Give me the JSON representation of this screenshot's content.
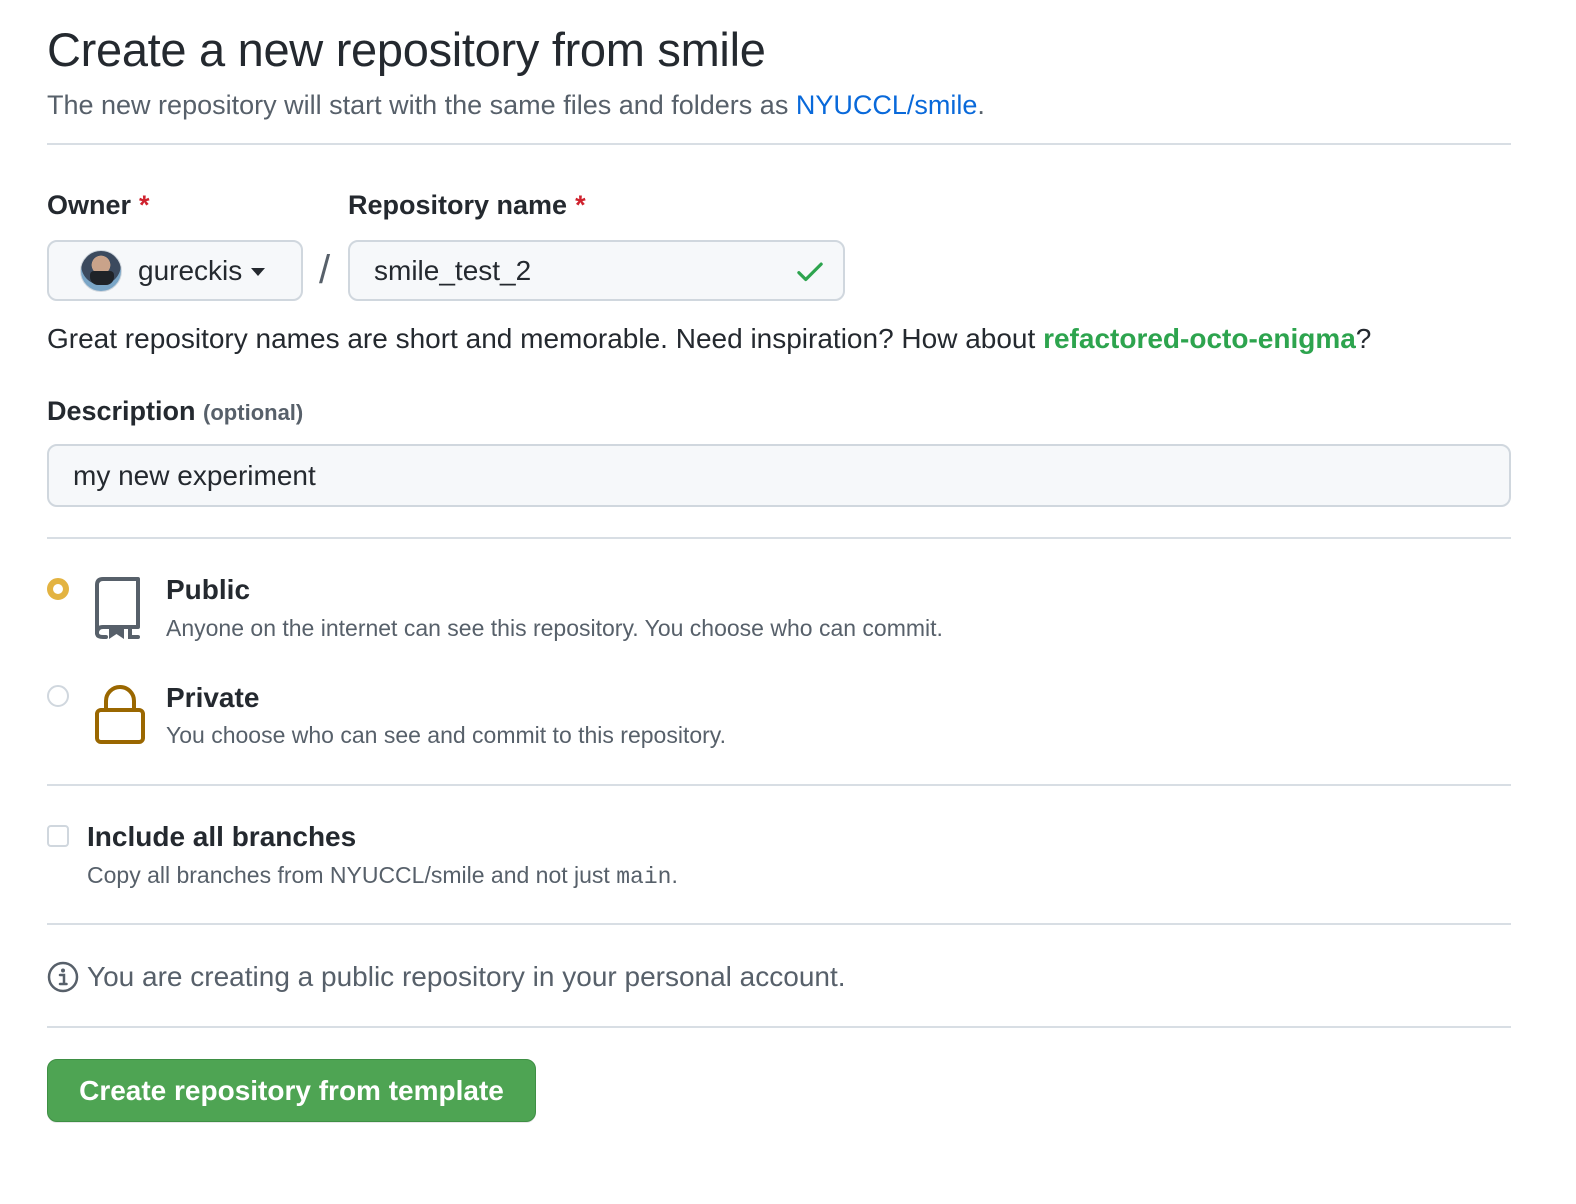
{
  "header": {
    "title": "Create a new repository from smile",
    "subtitle_prefix": "The new repository will start with the same files and folders as ",
    "subtitle_link": "NYUCCL/smile",
    "subtitle_suffix": "."
  },
  "owner": {
    "label": "Owner",
    "required_mark": "*",
    "value": "gureckis"
  },
  "separator": "/",
  "repo_name": {
    "label": "Repository name",
    "required_mark": "*",
    "value": "smile_test_2",
    "valid_icon": "check-icon"
  },
  "name_hint": {
    "prefix": "Great repository names are short and memorable. Need inspiration? How about ",
    "suggestion": "refactored-octo-enigma",
    "suffix": "?"
  },
  "description": {
    "label": "Description",
    "optional": "(optional)",
    "value": "my new experiment"
  },
  "visibility": {
    "public": {
      "title": "Public",
      "desc": "Anyone on the internet can see this repository. You choose who can commit.",
      "checked": true,
      "icon": "repo-icon"
    },
    "private": {
      "title": "Private",
      "desc": "You choose who can see and commit to this repository.",
      "checked": false,
      "icon": "lock-icon"
    }
  },
  "branches": {
    "title": "Include all branches",
    "desc_prefix": "Copy all branches from NYUCCL/smile and not just ",
    "desc_code": "main",
    "desc_suffix": ".",
    "checked": false
  },
  "info": {
    "icon": "info-icon",
    "text": "You are creating a public repository in your personal account."
  },
  "submit": {
    "label": "Create repository from template"
  },
  "colors": {
    "link": "#0969da",
    "suggestion": "#2da44e",
    "required": "#cf222e",
    "submit_bg": "#4ea453",
    "radio_checked": "#e3b341",
    "lock_icon": "#9a6700"
  }
}
